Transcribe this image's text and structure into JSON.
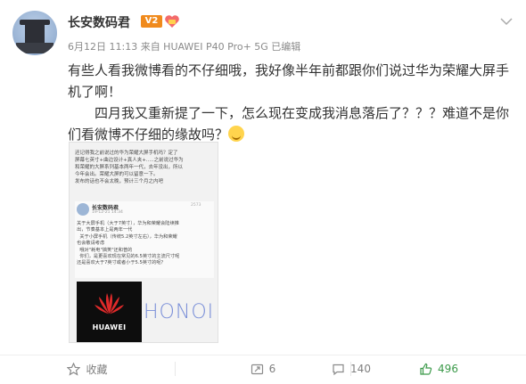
{
  "user": {
    "name": "长安数码君",
    "badge": "V2",
    "meta": "6月12日 11:13 来自 HUAWEI P40 Pro+ 5G  已编辑"
  },
  "post": {
    "paragraph1": "有些人看我微博看的不仔细哦，我好像半年前都跟你们说过华为荣耀大屏手机了啊！",
    "paragraph2": "四月我又重新提了一下，怎么现在变成我消息落后了？？？难道不是你们看微博不仔细的缘故吗？"
  },
  "embedded": {
    "top_text": "还记得我之前说过的华为荣耀大屏手机吗？定了\n屏幕七英寸+曲边设计+真人夹+.....之前说过华为\n和荣耀的大屏系列基本两年一代，去年没出，所以\n今年会出。荣耀大屏的可以留意一下。\n发布的话也不会太晚，预计三个月之内吧",
    "inner_name": "长安数码君",
    "inner_date": "19-12-21 14:34",
    "inner_stat": "2573",
    "inner_body": "关于大屏手机（大于7英寸），华为和荣耀会陆续推\n出，节奏基本上是两年一代\n  关于小屏手机（传统5.2英寸左右），华为和荣耀\n也会敬请考虑\n  哦对\"耗电\"搞笑\"还和普的\n  你们，是更喜欢现在常见的6.5英寸的主流尺寸呢\n还是喜欢大于7英寸或者小于5.5英寸的呢？",
    "huawei_word": "HUAWEI",
    "honor_word": "HONOI"
  },
  "actions": {
    "favorite_label": "收藏",
    "repost_count": "6",
    "comment_count": "140",
    "like_count": "496"
  },
  "colors": {
    "badge_orange": "#f08a1c",
    "huawei_red": "#e02a2a",
    "honor_blue": "#7a8fd8"
  }
}
